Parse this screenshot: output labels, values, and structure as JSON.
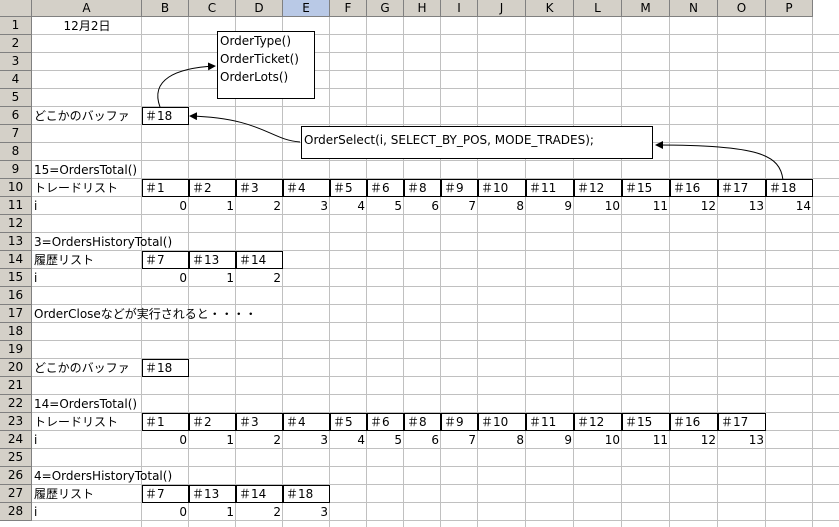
{
  "columns": [
    "A",
    "B",
    "C",
    "D",
    "E",
    "F",
    "G",
    "H",
    "I",
    "J",
    "K",
    "L",
    "M",
    "N",
    "O",
    "P"
  ],
  "selected_column": "E",
  "rows": [
    "1",
    "2",
    "3",
    "4",
    "5",
    "6",
    "7",
    "8",
    "9",
    "10",
    "11",
    "12",
    "13",
    "14",
    "15",
    "16",
    "17",
    "18",
    "19",
    "20",
    "21",
    "22",
    "23",
    "24",
    "25",
    "26",
    "27",
    "28"
  ],
  "cells": {
    "r1_date": "12月2日",
    "r6_label": "どこかのバッファ",
    "r6_buffer": "＃18",
    "r9_label": "15=OrdersTotal()",
    "r10_label": "トレードリスト",
    "r10_items": [
      "＃1",
      "＃2",
      "＃3",
      "＃4",
      "＃5",
      "＃6",
      "＃8",
      "＃9",
      "＃10",
      "＃11",
      "＃12",
      "＃15",
      "＃16",
      "＃17",
      "＃18"
    ],
    "r11_label": "i",
    "r11_idx": [
      "0",
      "1",
      "2",
      "3",
      "4",
      "5",
      "6",
      "7",
      "8",
      "9",
      "10",
      "11",
      "12",
      "13",
      "14"
    ],
    "r13_label": "3=OrdersHistoryTotal()",
    "r14_label": "履歴リスト",
    "r14_items": [
      "＃7",
      "＃13",
      "＃14"
    ],
    "r15_label": "i",
    "r15_idx": [
      "0",
      "1",
      "2"
    ],
    "r17_label": "OrderCloseなどが実行されると・・・・",
    "r20_label": "どこかのバッファ",
    "r20_buffer": "＃18",
    "r22_label": "14=OrdersTotal()",
    "r23_label": "トレードリスト",
    "r23_items": [
      "＃1",
      "＃2",
      "＃3",
      "＃4",
      "＃5",
      "＃6",
      "＃8",
      "＃9",
      "＃10",
      "＃11",
      "＃12",
      "＃15",
      "＃16",
      "＃17"
    ],
    "r24_label": "i",
    "r24_idx": [
      "0",
      "1",
      "2",
      "3",
      "4",
      "5",
      "6",
      "7",
      "8",
      "9",
      "10",
      "11",
      "12",
      "13"
    ],
    "r26_label": "4=OrdersHistoryTotal()",
    "r27_label": "履歴リスト",
    "r27_items": [
      "＃7",
      "＃13",
      "＃14",
      "＃18"
    ],
    "r28_label": "i",
    "r28_idx": [
      "0",
      "1",
      "2",
      "3"
    ]
  },
  "callout_functions": [
    "OrderType()",
    "OrderTicket()",
    "OrderLots()"
  ],
  "callout_select": "OrderSelect(i, SELECT_BY_POS, MODE_TRADES);"
}
